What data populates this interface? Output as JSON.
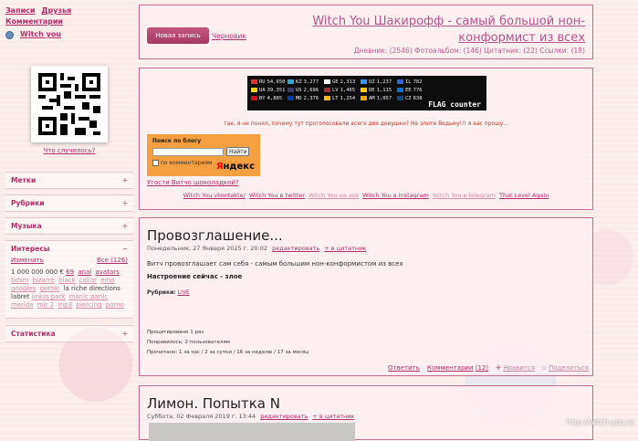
{
  "topnav": {
    "records": "Записи",
    "friends": "Друзья",
    "comments": "Комментарии",
    "user": "Witch you"
  },
  "qr": {
    "what_link": "Что случилось?"
  },
  "sidebar": {
    "blocks": [
      {
        "label": "Метки"
      },
      {
        "label": "Рубрики"
      },
      {
        "label": "Музыка"
      }
    ],
    "interests": {
      "label": "Интересы",
      "edit": "Изменить",
      "all": "Все (126)",
      "tags": [
        "1 000 000 000 €",
        "69",
        "anal",
        "avatars",
        "bdsm",
        "bizarre",
        "black",
        "collar",
        "emo",
        "googles",
        "gothic",
        "la riche directions labret",
        "linkin park",
        "manic panic",
        "merida",
        "mir 2",
        "mp3",
        "piercing",
        "porno"
      ]
    },
    "statistics": {
      "label": "Статистика"
    }
  },
  "header": {
    "new_post": "Новая запись",
    "drafts": "Черновик",
    "title": "Witch You Шакирофф - самый большой нон-конформист из всех",
    "stats": "Дневник: (2546)  Фотоальбом: (146)  Цитатник: (22)  Ссылки: (18)"
  },
  "flag_counter": {
    "brand": "FLAG counter",
    "entries": [
      {
        "cc": "RU",
        "n": "54,650",
        "color": "#dd3333"
      },
      {
        "cc": "KZ",
        "n": "3,277",
        "color": "#33a9d6"
      },
      {
        "cc": "GE",
        "n": "2,313",
        "color": "#ffffff"
      },
      {
        "cc": "UZ",
        "n": "1,237",
        "color": "#3399ff"
      },
      {
        "cc": "IL",
        "n": "782",
        "color": "#3366cc"
      },
      {
        "cc": "",
        "n": "",
        "color": "#000000"
      },
      {
        "cc": "UA",
        "n": "39,351",
        "color": "#ffd500"
      },
      {
        "cc": "US",
        "n": "2,696",
        "color": "#3c3b6e"
      },
      {
        "cc": "LV",
        "n": "1,465",
        "color": "#9e3039"
      },
      {
        "cc": "DE",
        "n": "1,115",
        "color": "#ffce00"
      },
      {
        "cc": "EE",
        "n": "776",
        "color": "#0072ce"
      },
      {
        "cc": "",
        "n": "",
        "color": "#000000"
      },
      {
        "cc": "BY",
        "n": "4,885",
        "color": "#cf101a"
      },
      {
        "cc": "MD",
        "n": "2,376",
        "color": "#003da5"
      },
      {
        "cc": "LT",
        "n": "1,254",
        "color": "#fdb913"
      },
      {
        "cc": "AM",
        "n": "1,057",
        "color": "#f2a800"
      },
      {
        "cc": "CZ",
        "n": "638",
        "color": "#11457e"
      },
      {
        "cc": "",
        "n": "",
        "color": "#000000"
      }
    ]
  },
  "notice": "так, я не понял, почему тут проголосовали всего две девушки? Не злите Ведьму!!! я вас прошу...",
  "search": {
    "label": "Поиск по блогу",
    "button": "Найти",
    "checkbox": "по комментариям",
    "brand_red": "Я",
    "brand": "ндекс"
  },
  "chocolate": "Угости Витчо шоколадкой?",
  "social": [
    {
      "label": "Witch You vkontakte/",
      "dim": false
    },
    {
      "label": "Witch You в twitter",
      "dim": false
    },
    {
      "label": "Witch You на ask",
      "dim": true
    },
    {
      "label": "Witch You в Instagram",
      "dim": false
    },
    {
      "label": "Witch You в telegram",
      "dim": true
    },
    {
      "label": "That Level Again",
      "dim": false
    }
  ],
  "post1": {
    "title": "Провозглашение...",
    "date": "Понедельник, 27 Января 2025 г. 20:02",
    "edit": "редактировать",
    "quote": "+ в цитатник",
    "text": "Витч провозглашает сам себя - самым большим нон-конформистом из всех",
    "mood": "Настроение сейчас - злое",
    "rubrics_label": "Рубрики:",
    "rubric": "LIVE",
    "views": "Процитировано 1 раз",
    "liked": "Понравилось: 2 пользователям",
    "read": "Прочитано: 1 за час / 2 за сутки / 16 за неделю / 17 за месяц",
    "reply": "Ответить",
    "comments": "Комментарии",
    "comments_count": "(12)",
    "like": "Нравится",
    "share": "Поделиться"
  },
  "post2": {
    "title": "Лимон. Попытка N",
    "date": "Суббота, 02 Февраля 2019 г. 13:44",
    "edit": "редактировать",
    "quote": "+ в цитатник"
  },
  "watermark": "http://witch-you.ru"
}
